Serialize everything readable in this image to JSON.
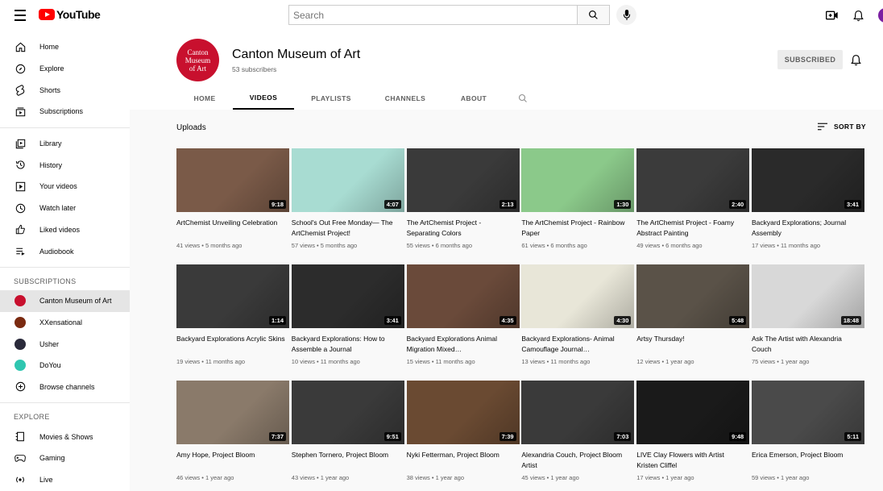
{
  "topbar": {
    "logo_text": "YouTube",
    "search_placeholder": "Search"
  },
  "sidebar": {
    "main": [
      {
        "label": "Home",
        "icon": "home-icon"
      },
      {
        "label": "Explore",
        "icon": "compass-icon"
      },
      {
        "label": "Shorts",
        "icon": "shorts-icon"
      },
      {
        "label": "Subscriptions",
        "icon": "subscriptions-icon"
      }
    ],
    "library": [
      {
        "label": "Library",
        "icon": "library-icon"
      },
      {
        "label": "History",
        "icon": "history-icon"
      },
      {
        "label": "Your videos",
        "icon": "your-videos-icon"
      },
      {
        "label": "Watch later",
        "icon": "clock-icon"
      },
      {
        "label": "Liked videos",
        "icon": "thumbs-up-icon"
      },
      {
        "label": "Audiobook",
        "icon": "playlist-icon"
      }
    ],
    "subscriptions_heading": "SUBSCRIPTIONS",
    "subscriptions": [
      {
        "label": "Canton Museum of Art",
        "color": "#c8102e"
      },
      {
        "label": "XXensational",
        "color": "#7a2a10"
      },
      {
        "label": "Usher",
        "color": "#2a2a3a"
      },
      {
        "label": "DoYou",
        "color": "#2fc6b0"
      },
      {
        "label": "Browse channels",
        "icon": "plus-circle-icon"
      }
    ],
    "explore_heading": "EXPLORE",
    "explore": [
      {
        "label": "Movies & Shows",
        "icon": "film-icon"
      },
      {
        "label": "Gaming",
        "icon": "gamepad-icon"
      },
      {
        "label": "Live",
        "icon": "live-icon"
      }
    ]
  },
  "channel": {
    "logo_lines": [
      "Canton",
      "Museum",
      "of Art"
    ],
    "name": "Canton Museum of Art",
    "subscribers": "53 subscribers",
    "subscribed_label": "SUBSCRIBED",
    "tabs": [
      "HOME",
      "VIDEOS",
      "PLAYLISTS",
      "CHANNELS",
      "ABOUT"
    ],
    "active_tab": "VIDEOS"
  },
  "content": {
    "section_title": "Uploads",
    "sort_label": "SORT BY"
  },
  "videos": [
    {
      "title": "ArtChemist Unveiling Celebration",
      "meta": "41 views • 5 months ago",
      "duration": "9:18",
      "thumb": "#7a5a48"
    },
    {
      "title": "School's Out Free Monday— The ArtChemist Project!",
      "meta": "57 views • 5 months ago",
      "duration": "4:07",
      "thumb": "#a8dcd2"
    },
    {
      "title": "The ArtChemist Project - Separating Colors",
      "meta": "55 views • 6 months ago",
      "duration": "2:13",
      "thumb": "#3a3a3a"
    },
    {
      "title": "The ArtChemist Project - Rainbow Paper",
      "meta": "61 views • 6 months ago",
      "duration": "1:30",
      "thumb": "#8bc98a"
    },
    {
      "title": "The ArtChemist Project - Foamy Abstract Painting",
      "meta": "49 views • 6 months ago",
      "duration": "2:40",
      "thumb": "#3b3b3b"
    },
    {
      "title": "Backyard Explorations; Journal Assembly",
      "meta": "17 views • 11 months ago",
      "duration": "3:41",
      "thumb": "#2a2a2a"
    },
    {
      "title": "Backyard Explorations Acrylic Skins",
      "meta": "19 views • 11 months ago",
      "duration": "1:14",
      "thumb": "#3a3a3a"
    },
    {
      "title": "Backyard Explorations: How to Assemble a Journal",
      "meta": "10 views • 11 months ago",
      "duration": "3:41",
      "thumb": "#2c2c2c"
    },
    {
      "title": "Backyard Explorations Animal Migration Mixed…",
      "meta": "15 views • 11 months ago",
      "duration": "4:35",
      "thumb": "#6a4a3a"
    },
    {
      "title": "Backyard Explorations- Animal Camouflage Journal…",
      "meta": "13 views • 11 months ago",
      "duration": "4:30",
      "thumb": "#e8e6d8"
    },
    {
      "title": "Artsy Thursday!",
      "meta": "12 views • 1 year ago",
      "duration": "5:48",
      "thumb": "#5a5248"
    },
    {
      "title": "Ask The Artist with Alexandria Couch",
      "meta": "75 views • 1 year ago",
      "duration": "18:48",
      "thumb": "#d8d8d8"
    },
    {
      "title": "Amy Hope, Project Bloom",
      "meta": "46 views • 1 year ago",
      "duration": "7:37",
      "thumb": "#8a7a6a"
    },
    {
      "title": "Stephen Tornero, Project Bloom",
      "meta": "43 views • 1 year ago",
      "duration": "9:51",
      "thumb": "#3a3a3a"
    },
    {
      "title": "Nyki Fetterman, Project Bloom",
      "meta": "38 views • 1 year ago",
      "duration": "7:39",
      "thumb": "#6a4a32"
    },
    {
      "title": "Alexandria Couch, Project Bloom Artist",
      "meta": "45 views • 1 year ago",
      "duration": "7:03",
      "thumb": "#3a3a3a"
    },
    {
      "title": "LIVE Clay Flowers with Artist Kristen Cliffel",
      "meta": "17 views • 1 year ago",
      "duration": "9:48",
      "thumb": "#1a1a1a"
    },
    {
      "title": "Erica Emerson, Project Bloom",
      "meta": "59 views • 1 year ago",
      "duration": "5:11",
      "thumb": "#4a4a4a"
    }
  ]
}
